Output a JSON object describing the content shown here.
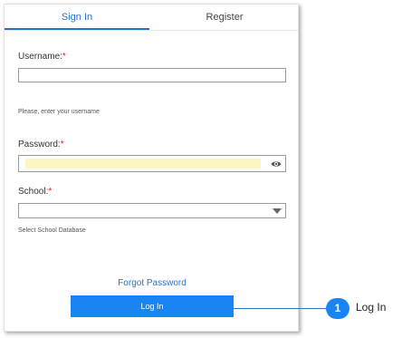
{
  "tabs": {
    "signin": "Sign In",
    "register": "Register"
  },
  "form": {
    "username": {
      "label": "Username:",
      "required_mark": "*",
      "value": "",
      "hint": "Please, enter your username"
    },
    "password": {
      "label": "Password:",
      "required_mark": "*",
      "value": ""
    },
    "school": {
      "label": "School:",
      "required_mark": "*",
      "value": "",
      "hint": "Select School Database"
    }
  },
  "links": {
    "forgot_password": "Forgot Password"
  },
  "buttons": {
    "login": "Log In"
  },
  "callout": {
    "number": "1",
    "label": "Log In"
  },
  "icons": {
    "password_toggle": "eye-icon",
    "school_dropdown": "chevron-down-icon"
  },
  "colors": {
    "accent": "#2a72c9",
    "button": "#1a85f2",
    "autofill": "#fcf5c4",
    "required": "#dd2222"
  }
}
